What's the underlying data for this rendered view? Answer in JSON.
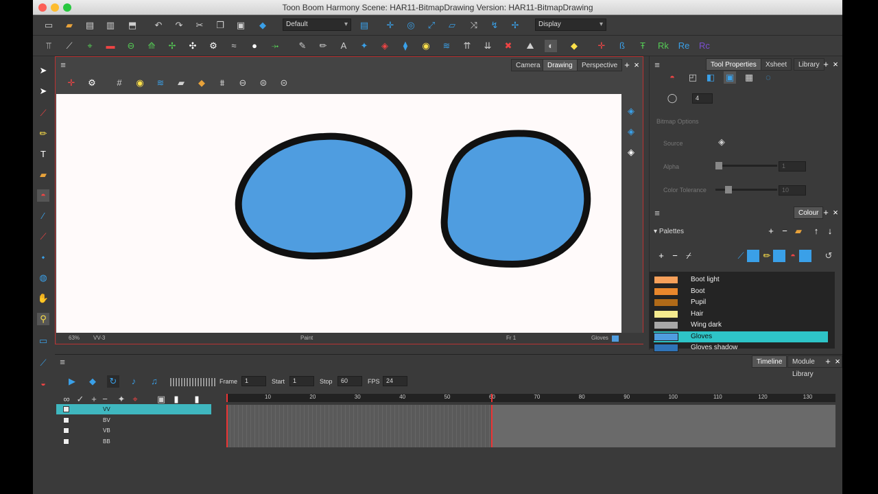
{
  "window": {
    "title": "Toon Boom Harmony Scene: HAR11-BitmapDrawing Version: HAR11-BitmapDrawing"
  },
  "toolbar": {
    "workspace_combo": "Default",
    "display_combo": "Display"
  },
  "view": {
    "tabs": [
      {
        "label": "Camera"
      },
      {
        "label": "Drawing"
      },
      {
        "label": "Perspective"
      }
    ],
    "status": {
      "zoom": "63%",
      "drawing": "VV-3",
      "tool": "Paint",
      "frame": "Fr 1",
      "colour": "Gloves"
    }
  },
  "props": {
    "tabs": [
      {
        "label": "Tool Properties"
      },
      {
        "label": "Xsheet"
      },
      {
        "label": "Library"
      }
    ],
    "size_value": "4",
    "bitmap_options": "Bitmap Options",
    "source_label": "Source",
    "alpha_label": "Alpha",
    "alpha_value": "1",
    "tolerance_label": "Color Tolerance",
    "tolerance_value": "10"
  },
  "colour": {
    "title": "Colour",
    "palettes_label": "Palettes",
    "swatches": [
      {
        "name": "Boot light",
        "color": "#f6a05a"
      },
      {
        "name": "Boot",
        "color": "#e9872c"
      },
      {
        "name": "Pupil",
        "color": "#b06a18"
      },
      {
        "name": "Hair",
        "color": "#f4ea8e"
      },
      {
        "name": "Wing dark",
        "color": "#a8a8a8"
      },
      {
        "name": "Gloves",
        "color": "#4f9de0"
      },
      {
        "name": "Gloves shadow",
        "color": "#2f74b8"
      }
    ],
    "accent": "#2ec4c7"
  },
  "timeline": {
    "tabs": [
      {
        "label": "Timeline"
      },
      {
        "label": "Module Library"
      }
    ],
    "frame_label": "Frame",
    "frame_value": "1",
    "start_label": "Start",
    "start_value": "1",
    "stop_label": "Stop",
    "stop_value": "60",
    "fps_label": "FPS",
    "fps_value": "24",
    "ruler": [
      "10",
      "20",
      "30",
      "40",
      "50",
      "60",
      "70",
      "80",
      "90",
      "100",
      "110",
      "120",
      "130"
    ],
    "layers": [
      {
        "name": "VV"
      },
      {
        "name": "BV"
      },
      {
        "name": "VB"
      },
      {
        "name": "BB"
      }
    ]
  },
  "drawing": {
    "fill": "#4f9de0",
    "outline": "#111111"
  }
}
